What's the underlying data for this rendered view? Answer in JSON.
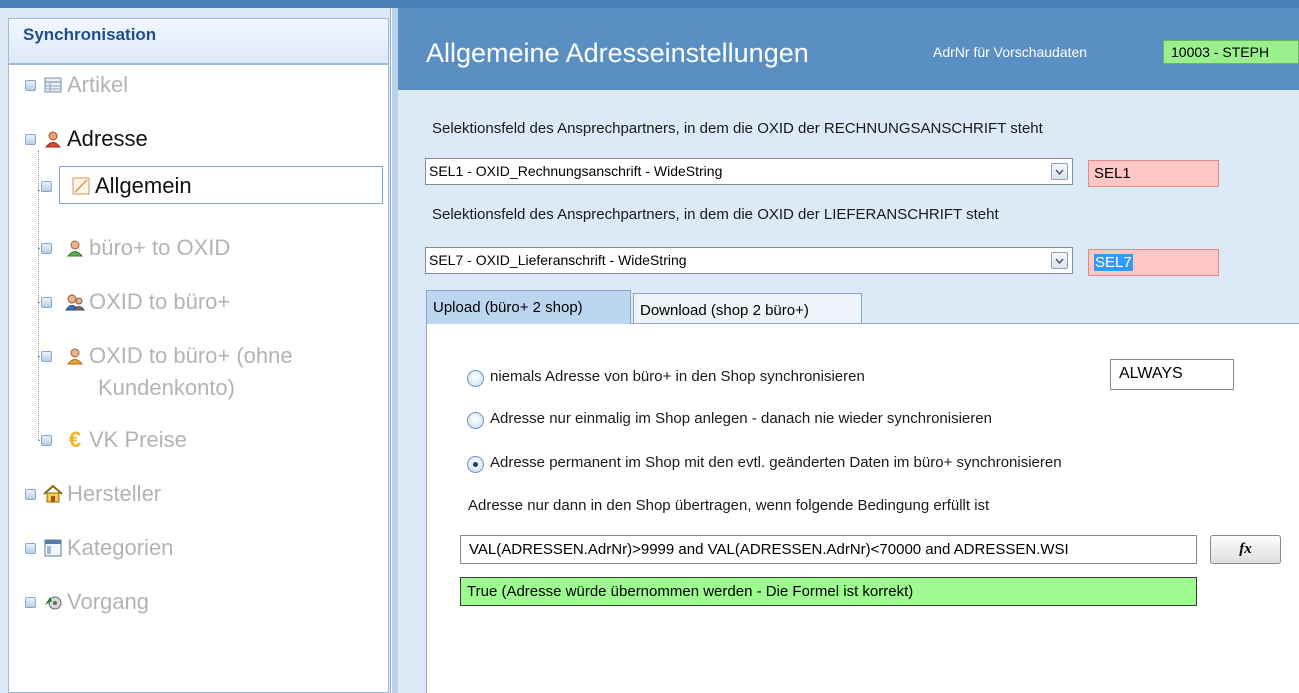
{
  "sidebar": {
    "title": "Synchronisation",
    "items": [
      {
        "label": "Artikel"
      },
      {
        "label": "Adresse"
      },
      {
        "label": "Allgemein"
      },
      {
        "label": "büro+ to OXID"
      },
      {
        "label": "OXID to büro+"
      },
      {
        "label": "OXID to büro+ (ohne"
      },
      {
        "label": "Kundenkonto)"
      },
      {
        "label": "VK Preise"
      },
      {
        "label": "Hersteller"
      },
      {
        "label": "Kategorien"
      },
      {
        "label": "Vorgang"
      }
    ]
  },
  "header": {
    "title": "Allgemeine Adresseinstellungen",
    "adr_label": "AdrNr für Vorschaudaten",
    "adr_value": "10003 - STEPH"
  },
  "form": {
    "rechnung_label": "Selektionsfeld des Ansprechpartners, in dem die OXID der RECHNUNGSANSCHRIFT steht",
    "rechnung_combo": "SEL1 - OXID_Rechnungsanschrift - WideString",
    "rechnung_field": "SEL1",
    "liefer_label": "Selektionsfeld des Ansprechpartners, in dem die OXID der LIEFERANSCHRIFT steht",
    "liefer_combo": "SEL7 - OXID_Lieferanschrift - WideString",
    "liefer_field": "SEL7"
  },
  "tabs": [
    {
      "label": "Upload (büro+ 2 shop)"
    },
    {
      "label": "Download (shop 2 büro+)"
    }
  ],
  "upload": {
    "option1": "niemals Adresse von büro+ in den Shop synchronisieren",
    "option2": "Adresse nur einmalig im Shop anlegen - danach nie wieder synchronisieren",
    "option3": "Adresse permanent im Shop mit den evtl. geänderten Daten im büro+ synchronisieren",
    "mode_value": "ALWAYS",
    "condition_label": "Adresse nur dann in den Shop übertragen, wenn folgende Bedingung erfüllt ist",
    "condition_formula": "VAL(ADRESSEN.AdrNr)>9999 and VAL(ADRESSEN.AdrNr)<70000 and ADRESSEN.WSI",
    "fx_label": "fx",
    "result": "True (Adresse würde übernommen werden - Die Formel ist korrekt)",
    "selected_option": 3
  }
}
